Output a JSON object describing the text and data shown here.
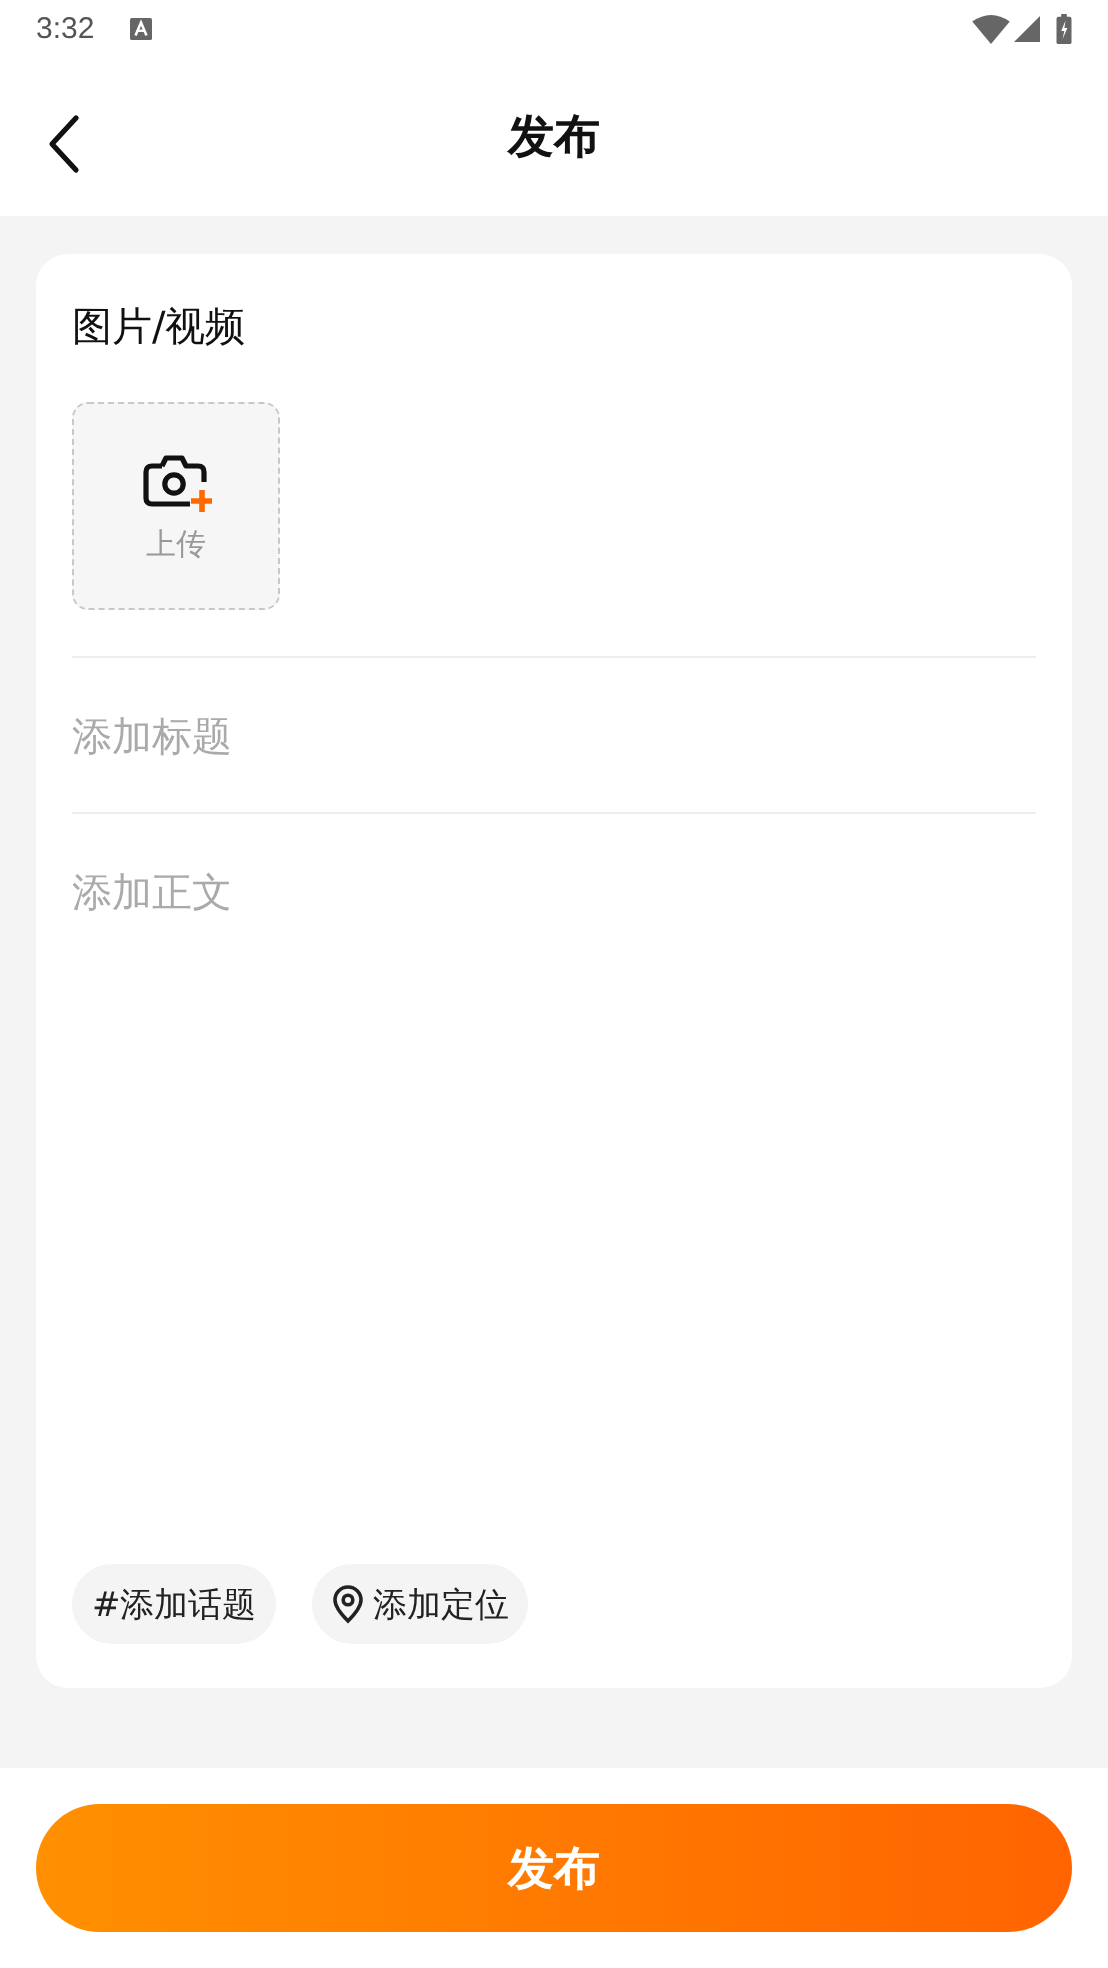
{
  "status_bar": {
    "time": "3:32"
  },
  "header": {
    "title": "发布"
  },
  "media": {
    "label": "图片/视频",
    "upload_label": "上传"
  },
  "title_field": {
    "placeholder": "添加标题"
  },
  "body_field": {
    "placeholder": "添加正文"
  },
  "tags": [
    {
      "kind": "topic",
      "label": "#添加话题"
    },
    {
      "kind": "location",
      "label": "添加定位"
    }
  ],
  "publish_button": {
    "label": "发布"
  }
}
